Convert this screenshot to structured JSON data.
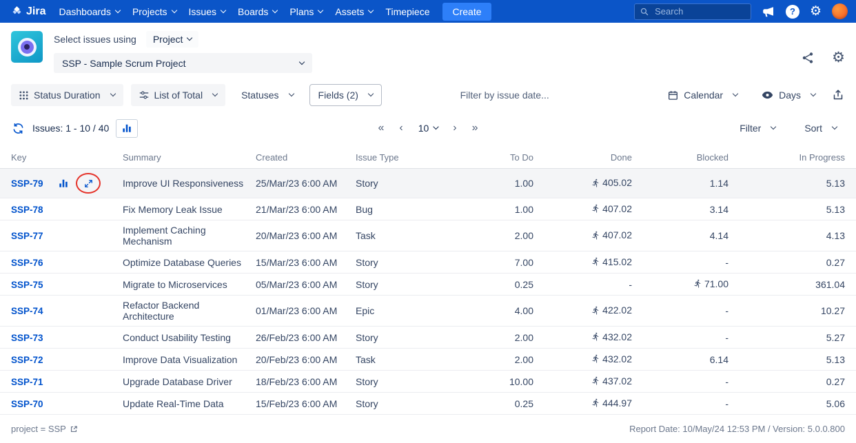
{
  "colors": {
    "nav_background": "#0b55c8",
    "create_button": "#2d7ff9",
    "link_blue": "#0052cc",
    "highlight_row": "#f4f5f7",
    "annotation_red": "#e5332a",
    "app_logo_teal": "#1fb6d4",
    "avatar_orange": "#f4511e"
  },
  "topnav": {
    "logo_text": "Jira",
    "menu": [
      {
        "label": "Dashboards"
      },
      {
        "label": "Projects"
      },
      {
        "label": "Issues"
      },
      {
        "label": "Boards"
      },
      {
        "label": "Plans"
      },
      {
        "label": "Assets"
      },
      {
        "label": "Timepiece"
      }
    ],
    "create_label": "Create",
    "search_placeholder": "Search"
  },
  "header": {
    "select_issues_label": "Select issues using",
    "mode_value": "Project",
    "project_value": "SSP - Sample Scrum Project"
  },
  "toolbar": {
    "status_duration_label": "Status Duration",
    "list_of_total_label": "List of Total",
    "statuses_label": "Statuses",
    "fields_label": "Fields (2)",
    "date_filter_placeholder": "Filter by issue date...",
    "calendar_label": "Calendar",
    "days_label": "Days"
  },
  "listbar": {
    "issues_count_label": "Issues: 1 - 10 / 40",
    "first_symbol": "«",
    "prev_symbol": "‹",
    "page_size": "10",
    "next_symbol": "›",
    "last_symbol": "»",
    "filter_label": "Filter",
    "sort_label": "Sort"
  },
  "table": {
    "columns": [
      "Key",
      "Summary",
      "Created",
      "Issue Type",
      "To Do",
      "Done",
      "Blocked",
      "In Progress"
    ],
    "rows": [
      {
        "key": "SSP-79",
        "summary": "Improve UI Responsiveness",
        "created": "25/Mar/23 6:00 AM",
        "issue_type": "Story",
        "to_do": "1.00",
        "done": "405.02",
        "done_icon": true,
        "blocked": "1.14",
        "in_progress": "5.13",
        "highlighted": true
      },
      {
        "key": "SSP-78",
        "summary": "Fix Memory Leak Issue",
        "created": "21/Mar/23 6:00 AM",
        "issue_type": "Bug",
        "to_do": "1.00",
        "done": "407.02",
        "done_icon": true,
        "blocked": "3.14",
        "in_progress": "5.13"
      },
      {
        "key": "SSP-77",
        "summary": "Implement Caching Mechanism",
        "created": "20/Mar/23 6:00 AM",
        "issue_type": "Task",
        "to_do": "2.00",
        "done": "407.02",
        "done_icon": true,
        "blocked": "4.14",
        "in_progress": "4.13"
      },
      {
        "key": "SSP-76",
        "summary": "Optimize Database Queries",
        "created": "15/Mar/23 6:00 AM",
        "issue_type": "Story",
        "to_do": "7.00",
        "done": "415.02",
        "done_icon": true,
        "blocked": "-",
        "in_progress": "0.27"
      },
      {
        "key": "SSP-75",
        "summary": "Migrate to Microservices",
        "created": "05/Mar/23 6:00 AM",
        "issue_type": "Story",
        "to_do": "0.25",
        "done": "-",
        "blocked": "71.00",
        "blocked_icon": true,
        "in_progress": "361.04"
      },
      {
        "key": "SSP-74",
        "summary": "Refactor Backend Architecture",
        "created": "01/Mar/23 6:00 AM",
        "issue_type": "Epic",
        "to_do": "4.00",
        "done": "422.02",
        "done_icon": true,
        "blocked": "-",
        "in_progress": "10.27"
      },
      {
        "key": "SSP-73",
        "summary": "Conduct Usability Testing",
        "created": "26/Feb/23 6:00 AM",
        "issue_type": "Story",
        "to_do": "2.00",
        "done": "432.02",
        "done_icon": true,
        "blocked": "-",
        "in_progress": "5.27"
      },
      {
        "key": "SSP-72",
        "summary": "Improve Data Visualization",
        "created": "20/Feb/23 6:00 AM",
        "issue_type": "Task",
        "to_do": "2.00",
        "done": "432.02",
        "done_icon": true,
        "blocked": "6.14",
        "in_progress": "5.13"
      },
      {
        "key": "SSP-71",
        "summary": "Upgrade Database Driver",
        "created": "18/Feb/23 6:00 AM",
        "issue_type": "Story",
        "to_do": "10.00",
        "done": "437.02",
        "done_icon": true,
        "blocked": "-",
        "in_progress": "0.27"
      },
      {
        "key": "SSP-70",
        "summary": "Update Real-Time Data",
        "created": "15/Feb/23 6:00 AM",
        "issue_type": "Story",
        "to_do": "0.25",
        "done": "444.97",
        "done_icon": true,
        "blocked": "-",
        "in_progress": "5.06"
      }
    ]
  },
  "footer": {
    "query_label": "project = SSP",
    "report_label": "Report Date: 10/May/24 12:53 PM / Version: 5.0.0.800"
  }
}
